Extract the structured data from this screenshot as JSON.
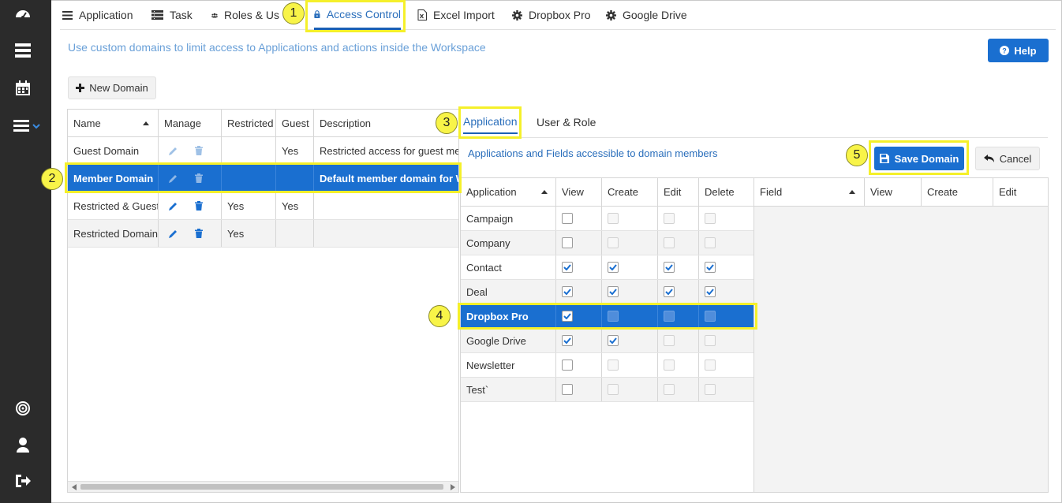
{
  "nav": {
    "tabs": [
      {
        "label": "Application",
        "icon": "menu-icon"
      },
      {
        "label": "Task",
        "icon": "list-icon"
      },
      {
        "label": "Roles & Us",
        "icon": "users-icon"
      },
      {
        "label": "Access Control",
        "icon": "lock-icon",
        "active": true
      },
      {
        "label": "Excel Import",
        "icon": "excel-icon"
      },
      {
        "label": "Dropbox Pro",
        "icon": "gear-icon"
      },
      {
        "label": "Google Drive",
        "icon": "gear-icon"
      }
    ]
  },
  "page": {
    "subtitle": "Use custom domains to limit access to Applications and actions inside the Workspace",
    "help_label": "Help",
    "new_domain_label": "New Domain"
  },
  "domains": {
    "columns": [
      "Name",
      "Manage",
      "Restricted",
      "Guest",
      "Description"
    ],
    "rows": [
      {
        "name": "Guest Domain",
        "restricted": "",
        "guest": "Yes",
        "description": "Restricted access for guest memb"
      },
      {
        "name": "Member Domain",
        "restricted": "",
        "guest": "",
        "description": "Default member domain for Work",
        "selected": true
      },
      {
        "name": "Restricted & Guest D",
        "restricted": "Yes",
        "guest": "Yes",
        "description": ""
      },
      {
        "name": "Restricted Domain",
        "restricted": "Yes",
        "guest": "",
        "description": ""
      }
    ]
  },
  "detail": {
    "tabs": [
      "Application",
      "User & Role"
    ],
    "active_tab": "Application",
    "subtitle": "Applications and Fields accessible to domain members",
    "save_label": "Save Domain",
    "cancel_label": "Cancel"
  },
  "apps": {
    "columns": [
      "Application",
      "View",
      "Create",
      "Edit",
      "Delete"
    ],
    "rows": [
      {
        "name": "Campaign",
        "view": false,
        "create": null,
        "edit": null,
        "delete": null
      },
      {
        "name": "Company",
        "view": false,
        "create": null,
        "edit": null,
        "delete": null
      },
      {
        "name": "Contact",
        "view": true,
        "create": true,
        "edit": true,
        "delete": true
      },
      {
        "name": "Deal",
        "view": true,
        "create": true,
        "edit": true,
        "delete": true
      },
      {
        "name": "Dropbox Pro",
        "view": true,
        "create": null,
        "edit": null,
        "delete": null,
        "selected": true
      },
      {
        "name": "Google Drive",
        "view": true,
        "create": true,
        "edit": null,
        "delete": null
      },
      {
        "name": "Newsletter",
        "view": false,
        "create": null,
        "edit": null,
        "delete": null
      },
      {
        "name": "Test`",
        "view": false,
        "create": null,
        "edit": null,
        "delete": null
      }
    ]
  },
  "fields": {
    "columns": [
      "Field",
      "View",
      "Create",
      "Edit"
    ]
  },
  "callouts": [
    "1",
    "2",
    "3",
    "4",
    "5"
  ],
  "colors": {
    "accent": "#1a6fd0",
    "highlight": "#f5f02a",
    "rail": "#2b2b2b"
  }
}
